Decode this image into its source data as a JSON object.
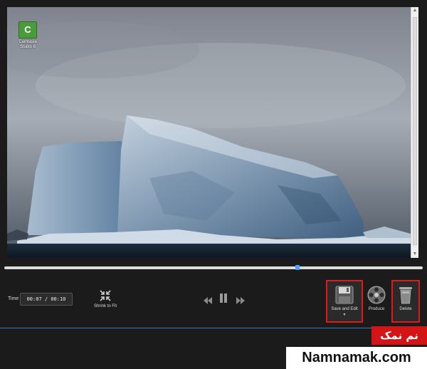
{
  "desktop_icon": {
    "glyph": "C",
    "label": "Camtasia Studio 8"
  },
  "timeline": {
    "position_fraction": 0.7
  },
  "controls": {
    "time_label": "Time",
    "current_time": "00:07",
    "separator": "/",
    "total_time": "00:10",
    "shrink_to_fit_label": "Shrink to Fit"
  },
  "actions": {
    "save_and_edit_label": "Save and Edit",
    "produce_label": "Produce",
    "delete_label": "Delete"
  },
  "watermark": {
    "tag": "نم نمک",
    "site": "Namnamak.com"
  },
  "colors": {
    "accent": "#4aa3ff",
    "highlight": "#e01919",
    "watermark_red": "#d41517"
  }
}
